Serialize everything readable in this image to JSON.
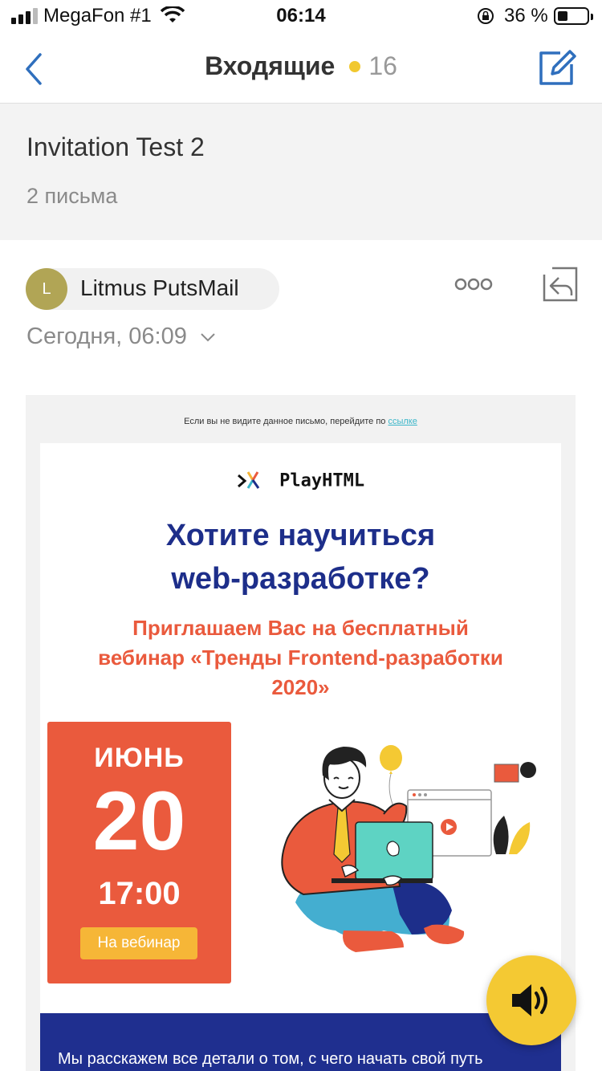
{
  "status_bar": {
    "carrier": "MegaFon #1",
    "time": "06:14",
    "battery_percent": "36 %",
    "battery_level": 0.36
  },
  "nav": {
    "title": "Входящие",
    "unread_count": "16",
    "accent_color": "#2f6fbd",
    "icons": [
      "back-chevron-icon",
      "compose-icon"
    ]
  },
  "thread": {
    "subject": "Invitation Test 2",
    "message_count": "2 письма"
  },
  "message": {
    "avatar_letter": "L",
    "sender": "Litmus PutsMail",
    "date": "Сегодня, 06:09",
    "icons": [
      "more-icon",
      "reply-icon",
      "chevron-down-icon"
    ]
  },
  "email": {
    "preheader": "Если вы не видите данное письмо, перейдите по",
    "preheader_link": "ссылке",
    "logo_text": "PlayHTML",
    "headline_line1": "Хотите научиться",
    "headline_line2": "web-разработке?",
    "subhead_line1": "Приглашаем Вас на бесплатный",
    "subhead_line2": "вебинар «Тренды Frontend-разработки",
    "subhead_line3": "2020»",
    "event": {
      "month": "ИЮНЬ",
      "day": "20",
      "time": "17:00",
      "button": "На вебинар"
    },
    "band_text": "Мы расскажем все детали о том, с чего начать свой путь",
    "colors": {
      "headline": "#1d2e8a",
      "accent_orange": "#ea5a3d",
      "button": "#f6b637",
      "band": "#1f2f8f"
    }
  },
  "floating": {
    "icon": "speaker-icon",
    "color": "#f4c933"
  }
}
